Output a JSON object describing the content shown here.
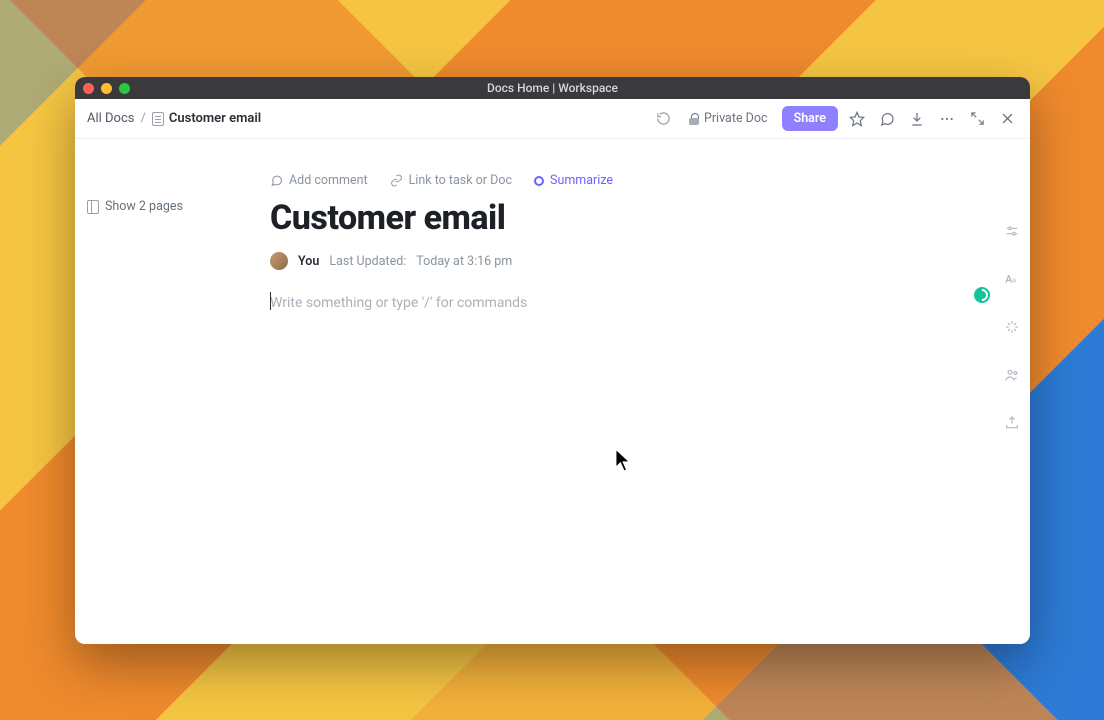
{
  "window": {
    "title": "Docs Home | Workspace"
  },
  "breadcrumb": {
    "root": "All Docs",
    "current": "Customer email"
  },
  "toolbar": {
    "private_label": "Private Doc",
    "share_label": "Share"
  },
  "sidebar": {
    "show_pages_label": "Show 2 pages"
  },
  "actions": {
    "add_comment": "Add comment",
    "link_task": "Link to task or Doc",
    "summarize": "Summarize"
  },
  "doc": {
    "title": "Customer email",
    "author_label": "You",
    "last_updated_prefix": "Last Updated:",
    "last_updated_value": "Today at 3:16 pm",
    "editor_placeholder": "Write something or type '/' for commands"
  }
}
